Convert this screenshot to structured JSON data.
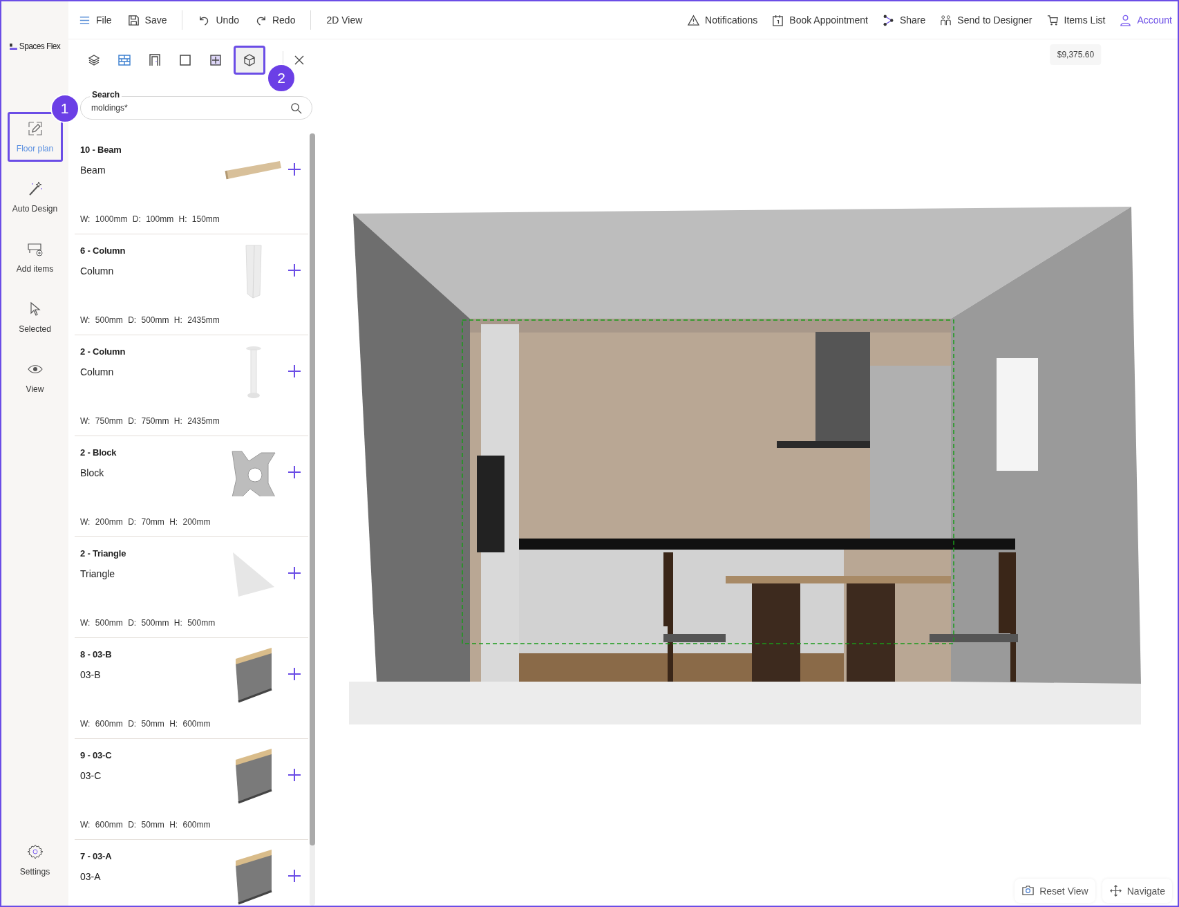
{
  "app": {
    "logo_text": "Spaces Flex"
  },
  "sidebar": {
    "items": [
      {
        "label": "Floor plan",
        "kind": "floorplan",
        "selected": true,
        "callout": "1"
      },
      {
        "label": "Auto Design",
        "kind": "wand",
        "selected": false
      },
      {
        "label": "Add items",
        "kind": "additems",
        "selected": false
      },
      {
        "label": "Selected",
        "kind": "pointer",
        "selected": false
      },
      {
        "label": "View",
        "kind": "eye",
        "selected": false
      }
    ],
    "settings": {
      "label": "Settings"
    }
  },
  "toolbar": {
    "left": [
      {
        "label": "File",
        "kind": "menu"
      },
      {
        "label": "Save",
        "kind": "save"
      },
      {
        "label": "Undo",
        "kind": "undo"
      },
      {
        "label": "Redo",
        "kind": "redo"
      },
      {
        "label": "2D View",
        "kind": "text"
      }
    ],
    "right": [
      {
        "label": "Notifications",
        "kind": "warning"
      },
      {
        "label": "Book Appointment",
        "kind": "calendar"
      },
      {
        "label": "Share",
        "kind": "share"
      },
      {
        "label": "Send to Designer",
        "kind": "people"
      },
      {
        "label": "Items List",
        "kind": "cart",
        "tooltip": "$9,375.60"
      },
      {
        "label": "Account",
        "kind": "user"
      }
    ]
  },
  "panel": {
    "tabs": [
      {
        "kind": "layers",
        "selected": false
      },
      {
        "kind": "walls",
        "selected": false
      },
      {
        "kind": "door",
        "selected": false
      },
      {
        "kind": "frame",
        "selected": false
      },
      {
        "kind": "window",
        "selected": false
      },
      {
        "kind": "box",
        "selected": true,
        "callout": "2"
      }
    ],
    "search": {
      "label": "Search",
      "value": "moldings*"
    },
    "items": [
      {
        "title": "10 - Beam",
        "name": "Beam",
        "dims": "W: 1000mm D: 100mm H: 150mm",
        "kind": "beam"
      },
      {
        "title": "6 - Column",
        "name": "Column",
        "dims": "W: 500mm D: 500mm H: 2435mm",
        "kind": "column"
      },
      {
        "title": "2 - Column",
        "name": "Column",
        "dims": "W: 750mm D: 750mm H: 2435mm",
        "kind": "round-column"
      },
      {
        "title": "2 - Block",
        "name": "Block",
        "dims": "W: 200mm D: 70mm H: 200mm",
        "kind": "block"
      },
      {
        "title": "2 - Triangle",
        "name": "Triangle",
        "dims": "W: 500mm D: 500mm H: 500mm",
        "kind": "triangle"
      },
      {
        "title": "8 - 03-B",
        "name": "03-B",
        "dims": "W: 600mm D: 50mm H: 600mm",
        "kind": "panel"
      },
      {
        "title": "9 - 03-C",
        "name": "03-C",
        "dims": "W: 600mm D: 50mm H: 600mm",
        "kind": "panel"
      },
      {
        "title": "7 - 03-A",
        "name": "03-A",
        "kind": "panel"
      }
    ]
  },
  "viewport": {
    "buttons": [
      {
        "label": "Reset View",
        "kind": "reset"
      },
      {
        "label": "Navigate",
        "kind": "move"
      }
    ]
  }
}
